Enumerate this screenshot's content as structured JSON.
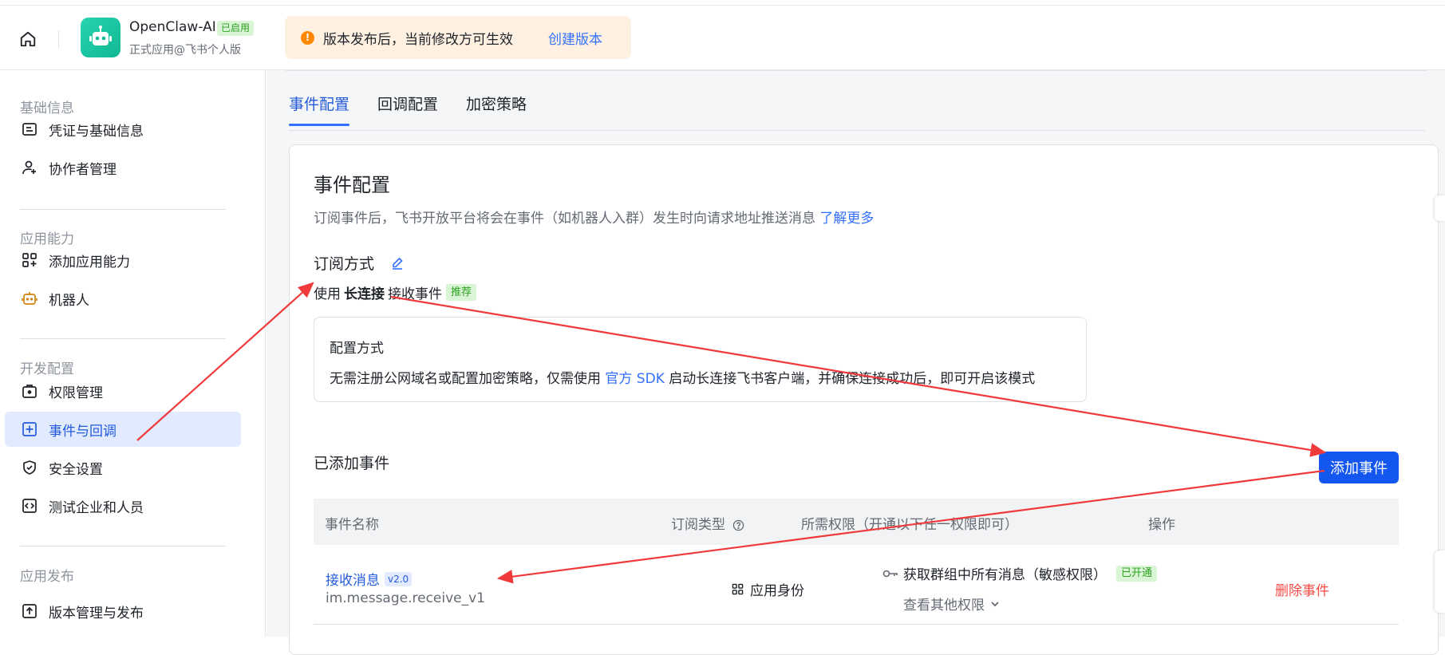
{
  "header": {
    "app_name": "OpenClaw-AI",
    "app_status": "已启用",
    "app_subtitle": "正式应用@飞书个人版",
    "notice_text": "版本发布后，当前修改方可生效",
    "notice_link": "创建版本"
  },
  "sidebar": {
    "sections": [
      {
        "title": "基础信息",
        "items": [
          {
            "label": "凭证与基础信息",
            "icon": "credential-icon"
          },
          {
            "label": "协作者管理",
            "icon": "add-user-icon"
          }
        ]
      },
      {
        "title": "应用能力",
        "items": [
          {
            "label": "添加应用能力",
            "icon": "app-grid-icon"
          },
          {
            "label": "机器人",
            "icon": "robot-icon"
          }
        ]
      },
      {
        "title": "开发配置",
        "items": [
          {
            "label": "权限管理",
            "icon": "briefcase-icon"
          },
          {
            "label": "事件与回调",
            "icon": "event-icon",
            "active": true
          },
          {
            "label": "安全设置",
            "icon": "shield-icon"
          },
          {
            "label": "测试企业和人员",
            "icon": "code-icon"
          }
        ]
      },
      {
        "title": "应用发布",
        "items": [
          {
            "label": "版本管理与发布",
            "icon": "upload-icon"
          }
        ]
      }
    ]
  },
  "tabs": [
    {
      "label": "事件配置",
      "active": true
    },
    {
      "label": "回调配置"
    },
    {
      "label": "加密策略"
    }
  ],
  "card": {
    "title": "事件配置",
    "desc": "订阅事件后，飞书开放平台将会在事件（如机器人入群）发生时向请求地址推送消息",
    "desc_link": "了解更多",
    "sub_title": "订阅方式",
    "mode_prefix": "使用",
    "mode_bold": "长连接",
    "mode_suffix": "接收事件",
    "mode_tag": "推荐",
    "config_title": "配置方式",
    "config_text_1": "无需注册公网域名或配置加密策略，仅需使用",
    "config_link": "官方 SDK",
    "config_text_2": "启动长连接飞书客户端，并确保连接成功后，即可开启该模式",
    "added_title": "已添加事件",
    "add_button": "添加事件"
  },
  "table": {
    "headers": {
      "name": "事件名称",
      "type": "订阅类型",
      "perm": "所需权限（开通以下任一权限即可）",
      "action": "操作"
    },
    "rows": [
      {
        "name": "接收消息",
        "version": "v2.0",
        "key": "im.message.receive_v1",
        "type": "应用身份",
        "permission": "获取群组中所有消息（敏感权限）",
        "perm_status": "已开通",
        "more_perm": "查看其他权限",
        "action": "删除事件"
      }
    ]
  },
  "colors": {
    "accent": "#3370ff",
    "primary_button": "#1456f0",
    "danger": "#f54a45",
    "success": "#2ea121",
    "annotation_arrow": "#f0393a"
  }
}
